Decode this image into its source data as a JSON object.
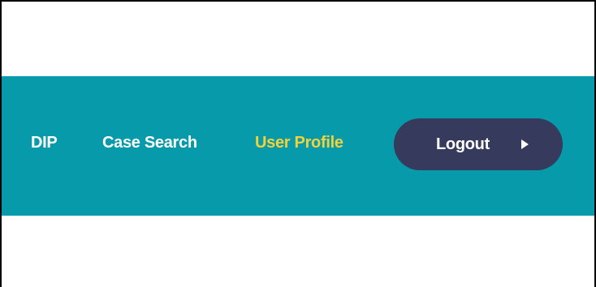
{
  "nav": {
    "items": [
      {
        "label": "DIP",
        "active": false
      },
      {
        "label": "Case Search",
        "active": false
      },
      {
        "label": "User Profile",
        "active": true
      }
    ],
    "logout_label": "Logout",
    "logout_icon": "play-arrow-icon"
  },
  "colors": {
    "navbar_bg": "#079aab",
    "nav_text": "#ffffff",
    "nav_active_text": "#f1d23a",
    "logout_bg": "#363a5c"
  }
}
